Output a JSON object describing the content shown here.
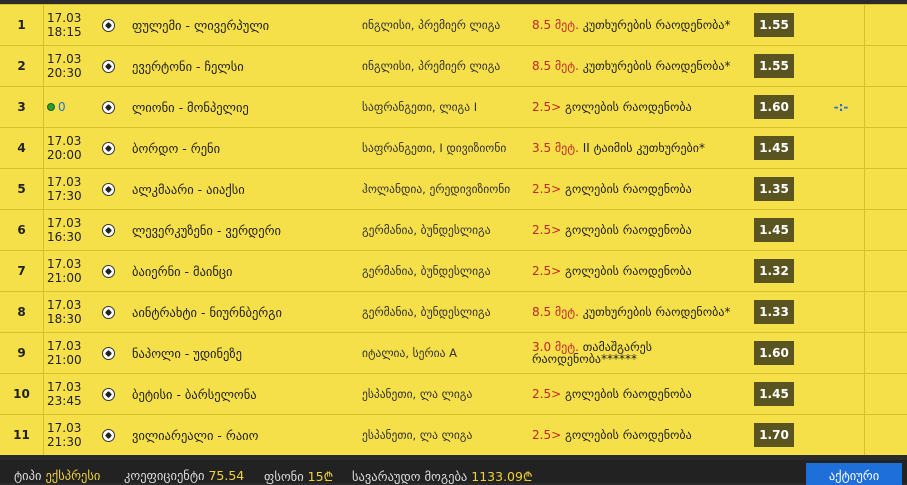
{
  "rows": [
    {
      "num": "1",
      "date": "17.03",
      "time": "18:15",
      "live": "",
      "match": "ფულემი - ლივერპული",
      "league": "ინგლისი, პრემიერ ლიგა",
      "bet_hl": "8.5 მეტ.",
      "bet_rest": " კუთხურების რაოდენობა*",
      "odd": "1.55",
      "extra": ""
    },
    {
      "num": "2",
      "date": "17.03",
      "time": "20:30",
      "live": "",
      "match": "ევერტონი - ჩელსი",
      "league": "ინგლისი, პრემიერ ლიგა",
      "bet_hl": "8.5 მეტ.",
      "bet_rest": " კუთხურების რაოდენობა*",
      "odd": "1.55",
      "extra": ""
    },
    {
      "num": "3",
      "date": "",
      "time": "",
      "live": "0",
      "match": "ლიონი - მონპელიე",
      "league": "საფრანგეთი, ლიგა I",
      "bet_hl": "2.5>",
      "bet_rest": " გოლების რაოდენობა",
      "odd": "1.60",
      "extra": "-:-"
    },
    {
      "num": "4",
      "date": "17.03",
      "time": "20:00",
      "live": "",
      "match": "ბორდო - რენი",
      "league": "საფრანგეთი, I დივიზიონი",
      "bet_hl": "3.5 მეტ.",
      "bet_rest": " II ტაიმის კუთხურები*",
      "odd": "1.45",
      "extra": ""
    },
    {
      "num": "5",
      "date": "17.03",
      "time": "17:30",
      "live": "",
      "match": "ალკმაარი - აიაქსი",
      "league": "ჰოლანდია, ერედივიზიონი",
      "bet_hl": "2.5>",
      "bet_rest": " გოლების რაოდენობა",
      "odd": "1.35",
      "extra": ""
    },
    {
      "num": "6",
      "date": "17.03",
      "time": "16:30",
      "live": "",
      "match": "ლევერკუზენი - ვერდერი",
      "league": "გერმანია, ბუნდესლიგა",
      "bet_hl": "2.5>",
      "bet_rest": " გოლების რაოდენობა",
      "odd": "1.45",
      "extra": ""
    },
    {
      "num": "7",
      "date": "17.03",
      "time": "21:00",
      "live": "",
      "match": "ბაიერნი - მაინცი",
      "league": "გერმანია, ბუნდესლიგა",
      "bet_hl": "2.5>",
      "bet_rest": " გოლების რაოდენობა",
      "odd": "1.32",
      "extra": ""
    },
    {
      "num": "8",
      "date": "17.03",
      "time": "18:30",
      "live": "",
      "match": "აინტრახტი - ნიურნბერგი",
      "league": "გერმანია, ბუნდესლიგა",
      "bet_hl": "8.5 მეტ.",
      "bet_rest": " კუთხურების რაოდენობა*",
      "odd": "1.33",
      "extra": ""
    },
    {
      "num": "9",
      "date": "17.03",
      "time": "21:00",
      "live": "",
      "match": "ნაპოლი - უდინეზე",
      "league": "იტალია, სერია A",
      "bet_hl": "3.0 მეტ.",
      "bet_rest": " თამაშგარეს რაოდენობა******",
      "odd": "1.60",
      "extra": ""
    },
    {
      "num": "10",
      "date": "17.03",
      "time": "23:45",
      "live": "",
      "match": "ბეტისი - ბარსელონა",
      "league": "ესპანეთი, ლა ლიგა",
      "bet_hl": "2.5>",
      "bet_rest": " გოლების რაოდენობა",
      "odd": "1.45",
      "extra": ""
    },
    {
      "num": "11",
      "date": "17.03",
      "time": "21:30",
      "live": "",
      "match": "ვილიარეალი - რაიო",
      "league": "ესპანეთი, ლა ლიგა",
      "bet_hl": "2.5>",
      "bet_rest": " გოლების რაოდენობა",
      "odd": "1.70",
      "extra": ""
    }
  ],
  "footer": {
    "type_label": "ტიპი",
    "type_value": "ექსპრესი",
    "coef_label": "კოეფიციენტი",
    "coef_value": "75.54",
    "money_label": "ფსონი",
    "money_value": "15₾",
    "win_label": "სავარაუდო მოგება",
    "win_value": "1133.09₾",
    "submit_label": "აქტიური"
  },
  "colors": {
    "row_bg": "#f6e04a",
    "odd_bg": "#5a5520",
    "accent": "#1e6fd9",
    "highlight": "#c0282a"
  }
}
